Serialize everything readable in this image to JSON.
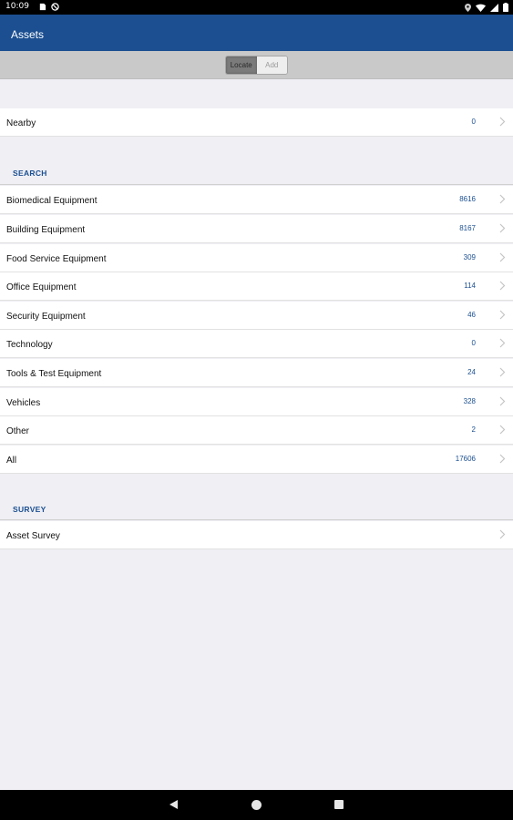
{
  "status_bar": {
    "time": "10:09",
    "icons": [
      "sd-card-icon",
      "no-disturb-icon",
      "location-icon",
      "wifi-icon",
      "signal-icon",
      "battery-icon"
    ]
  },
  "app_bar": {
    "title": "Assets",
    "color": "#1b4f91"
  },
  "segment": {
    "options": [
      "Locate",
      "Add"
    ],
    "selected": "Locate"
  },
  "nearby": {
    "label": "Nearby",
    "count": "0"
  },
  "search": {
    "header": "SEARCH",
    "items": [
      {
        "label": "Biomedical Equipment",
        "count": "8616"
      },
      {
        "label": "Building Equipment",
        "count": "8167"
      },
      {
        "label": "Food Service Equipment",
        "count": "309"
      },
      {
        "label": "Office Equipment",
        "count": "114"
      },
      {
        "label": "Security Equipment",
        "count": "46"
      },
      {
        "label": "Technology",
        "count": "0"
      },
      {
        "label": "Tools & Test Equipment",
        "count": "24"
      },
      {
        "label": "Vehicles",
        "count": "328"
      },
      {
        "label": "Other",
        "count": "2"
      },
      {
        "label": "All",
        "count": "17606"
      }
    ]
  },
  "survey": {
    "header": "SURVEY",
    "items": [
      {
        "label": "Asset Survey"
      }
    ]
  },
  "nav_bar": {
    "buttons": [
      "back-icon",
      "home-icon",
      "recents-icon"
    ]
  }
}
